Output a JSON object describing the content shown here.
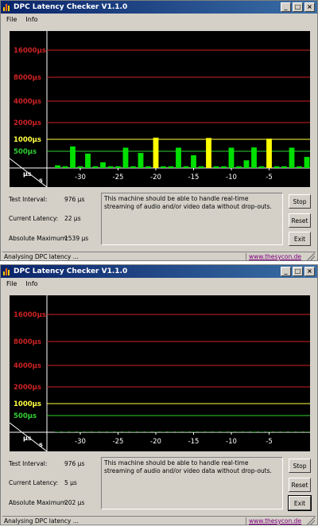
{
  "windows": [
    {
      "title": "DPC Latency Checker V1.1.0",
      "titlebar_buttons": [
        "_",
        "□",
        "×"
      ],
      "menu": [
        "File",
        "Info"
      ],
      "chart_data": {
        "type": "bar",
        "y_unit_label": "µs",
        "x_unit_label": "s",
        "y_ticks": [
          {
            "label": "16000µs",
            "value": 16000,
            "color": "#cc2222"
          },
          {
            "label": "8000µs",
            "value": 8000,
            "color": "#cc2222"
          },
          {
            "label": "4000µs",
            "value": 4000,
            "color": "#cc2222"
          },
          {
            "label": "2000µs",
            "value": 2000,
            "color": "#cc2222"
          },
          {
            "label": "1000µs",
            "value": 1000,
            "color": "#ffff40"
          },
          {
            "label": "500µs",
            "value": 500,
            "color": "#30d030"
          }
        ],
        "x_ticks": [
          "-30",
          "-25",
          "-20",
          "-15",
          "-10",
          "-5"
        ],
        "x_tick_values": [
          -30,
          -25,
          -20,
          -15,
          -10,
          -5
        ],
        "xlim": [
          -34,
          0
        ],
        "bars": [
          {
            "x": -33,
            "value": 80
          },
          {
            "x": -32,
            "value": 50
          },
          {
            "x": -31,
            "value": 700
          },
          {
            "x": -30,
            "value": 50
          },
          {
            "x": -29,
            "value": 430
          },
          {
            "x": -28,
            "value": 50
          },
          {
            "x": -27,
            "value": 170
          },
          {
            "x": -26,
            "value": 50
          },
          {
            "x": -25,
            "value": 50
          },
          {
            "x": -24,
            "value": 650
          },
          {
            "x": -23,
            "value": 50
          },
          {
            "x": -22,
            "value": 450
          },
          {
            "x": -21,
            "value": 50
          },
          {
            "x": -20,
            "value": 1100
          },
          {
            "x": -19,
            "value": 50
          },
          {
            "x": -18,
            "value": 50
          },
          {
            "x": -17,
            "value": 650
          },
          {
            "x": -16,
            "value": 50
          },
          {
            "x": -15,
            "value": 380
          },
          {
            "x": -14,
            "value": 50
          },
          {
            "x": -13,
            "value": 1080
          },
          {
            "x": -12,
            "value": 50
          },
          {
            "x": -11,
            "value": 50
          },
          {
            "x": -10,
            "value": 650
          },
          {
            "x": -9,
            "value": 50
          },
          {
            "x": -8,
            "value": 230
          },
          {
            "x": -7,
            "value": 660
          },
          {
            "x": -6,
            "value": 50
          },
          {
            "x": -5,
            "value": 1040
          },
          {
            "x": -4,
            "value": 50
          },
          {
            "x": -3,
            "value": 50
          },
          {
            "x": -2,
            "value": 650
          },
          {
            "x": -1,
            "value": 50
          },
          {
            "x": 0,
            "value": 330
          }
        ]
      },
      "info": {
        "test_interval_label": "Test Interval:",
        "test_interval_value": "976 µs",
        "current_latency_label": "Current Latency:",
        "current_latency_value": "22 µs",
        "absolute_maximum_label": "Absolute Maximum:",
        "absolute_maximum_value": "1539 µs"
      },
      "message": "This machine should be able to handle real-time streaming of audio and/or video data without drop-outs.",
      "buttons": {
        "stop": "Stop",
        "reset": "Reset",
        "exit": "Exit"
      },
      "status": {
        "text": "Analysing DPC latency ...",
        "link": "www.thesycon.de"
      }
    },
    {
      "title": "DPC Latency Checker V1.1.0",
      "titlebar_buttons": [
        "_",
        "□",
        "×"
      ],
      "menu": [
        "File",
        "Info"
      ],
      "chart_data": {
        "type": "bar",
        "y_unit_label": "µs",
        "x_unit_label": "s",
        "y_ticks": [
          {
            "label": "16000µs",
            "value": 16000,
            "color": "#cc2222"
          },
          {
            "label": "8000µs",
            "value": 8000,
            "color": "#cc2222"
          },
          {
            "label": "4000µs",
            "value": 4000,
            "color": "#cc2222"
          },
          {
            "label": "2000µs",
            "value": 2000,
            "color": "#cc2222"
          },
          {
            "label": "1000µs",
            "value": 1000,
            "color": "#ffff40"
          },
          {
            "label": "500µs",
            "value": 500,
            "color": "#30d030"
          }
        ],
        "x_ticks": [
          "-30",
          "-25",
          "-20",
          "-15",
          "-10",
          "-5"
        ],
        "x_tick_values": [
          -30,
          -25,
          -20,
          -15,
          -10,
          -5
        ],
        "xlim": [
          -34,
          0
        ],
        "bars": [
          {
            "x": -33,
            "value": 12
          },
          {
            "x": -32,
            "value": 10
          },
          {
            "x": -31,
            "value": 9
          },
          {
            "x": -30,
            "value": 10
          },
          {
            "x": -29,
            "value": 8
          },
          {
            "x": -28,
            "value": 9
          },
          {
            "x": -27,
            "value": 8
          },
          {
            "x": -26,
            "value": 9
          },
          {
            "x": -25,
            "value": 8
          },
          {
            "x": -24,
            "value": 8
          },
          {
            "x": -23,
            "value": 9
          },
          {
            "x": -22,
            "value": 8
          },
          {
            "x": -21,
            "value": 8
          },
          {
            "x": -20,
            "value": 8
          },
          {
            "x": -19,
            "value": 9
          },
          {
            "x": -18,
            "value": 8
          },
          {
            "x": -17,
            "value": 8
          },
          {
            "x": -16,
            "value": 8
          },
          {
            "x": -15,
            "value": 9
          },
          {
            "x": -14,
            "value": 8
          },
          {
            "x": -13,
            "value": 8
          },
          {
            "x": -12,
            "value": 8
          },
          {
            "x": -11,
            "value": 9
          },
          {
            "x": -10,
            "value": 8
          },
          {
            "x": -9,
            "value": 8
          },
          {
            "x": -8,
            "value": 8
          },
          {
            "x": -7,
            "value": 14
          },
          {
            "x": -6,
            "value": 10
          },
          {
            "x": -5,
            "value": 9
          },
          {
            "x": -4,
            "value": 8
          },
          {
            "x": -3,
            "value": 8
          },
          {
            "x": -2,
            "value": 9
          },
          {
            "x": -1,
            "value": 8
          },
          {
            "x": 0,
            "value": 8
          }
        ]
      },
      "info": {
        "test_interval_label": "Test Interval:",
        "test_interval_value": "976 µs",
        "current_latency_label": "Current Latency:",
        "current_latency_value": "5 µs",
        "absolute_maximum_label": "Absolute Maximum:",
        "absolute_maximum_value": "202 µs"
      },
      "message": "This machine should be able to handle real-time streaming of audio and/or video data without drop-outs.",
      "buttons": {
        "stop": "Stop",
        "reset": "Reset",
        "exit": "Exit"
      },
      "status": {
        "text": "Analysing DPC latency ...",
        "link": "www.thesycon.de"
      }
    }
  ]
}
